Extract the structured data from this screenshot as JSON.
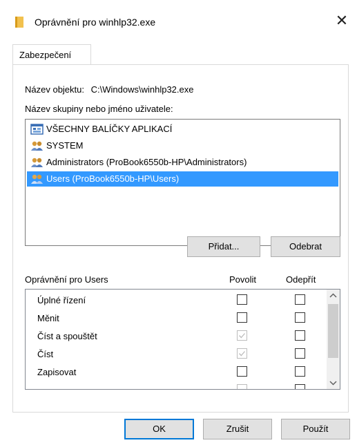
{
  "window": {
    "title": "Oprávnění pro winhlp32.exe",
    "close_symbol": "✕"
  },
  "tabs": [
    {
      "label": "Zabezpečení"
    }
  ],
  "object": {
    "label": "Název objektu:",
    "value": "C:\\Windows\\winhlp32.exe"
  },
  "groups": {
    "label_pre": "N",
    "label_underlined": "",
    "label_full": "Název skupiny nebo jméno uživatele:",
    "items": [
      {
        "label": "VŠECHNY BALÍČKY APLIKACÍ",
        "icon": "app-packages-icon"
      },
      {
        "label": "SYSTEM",
        "icon": "users-icon"
      },
      {
        "label": "Administrators (ProBook6550b-HP\\Administrators)",
        "icon": "users-icon"
      },
      {
        "label": "Users (ProBook6550b-HP\\Users)",
        "icon": "users-icon",
        "selected": true
      }
    ]
  },
  "buttons": {
    "add": "Přidat...",
    "remove": "Odebrat",
    "ok": "OK",
    "cancel": "Zrušit",
    "apply": "Použít"
  },
  "permissions": {
    "title": "Oprávnění pro Users",
    "col_allow": "Povolit",
    "col_deny": "Odepřít",
    "rows": [
      {
        "label": "Úplné řízení",
        "allow": false,
        "allow_disabled": false,
        "deny": false
      },
      {
        "label": "Měnit",
        "allow": false,
        "allow_disabled": false,
        "deny": false
      },
      {
        "label": "Číst a spouštět",
        "allow": true,
        "allow_disabled": true,
        "deny": false
      },
      {
        "label": "Číst",
        "allow": true,
        "allow_disabled": true,
        "deny": false
      },
      {
        "label": "Zapisovat",
        "allow": false,
        "allow_disabled": false,
        "deny": false
      }
    ]
  },
  "colors": {
    "selection": "#3399ff",
    "accent": "#0078d7",
    "button_face": "#e1e1e1"
  }
}
